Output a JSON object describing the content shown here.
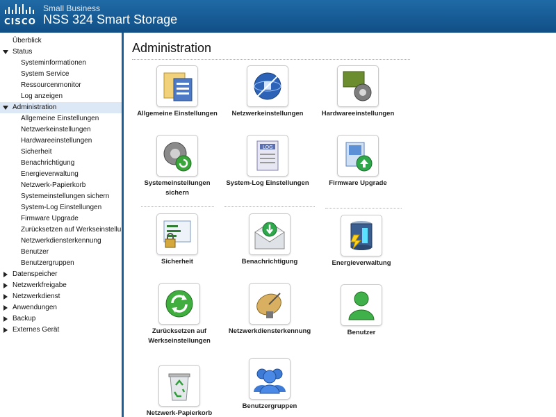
{
  "header": {
    "brand": "CISCO",
    "subtitle": "Small Business",
    "title": "NSS 324 Smart Storage"
  },
  "sidebar": {
    "items": [
      {
        "label": "Überblick",
        "level": "top"
      },
      {
        "label": "Status",
        "level": "top",
        "expanded": true
      },
      {
        "label": "Systeminformationen",
        "level": "sub"
      },
      {
        "label": "System Service",
        "level": "sub"
      },
      {
        "label": "Ressourcenmonitor",
        "level": "sub"
      },
      {
        "label": "Log anzeigen",
        "level": "sub"
      },
      {
        "label": "Administration",
        "level": "top",
        "expanded": true,
        "selected": true
      },
      {
        "label": "Allgemeine Einstellungen",
        "level": "sub"
      },
      {
        "label": "Netzwerkeinstellungen",
        "level": "sub"
      },
      {
        "label": "Hardwareeinstellungen",
        "level": "sub"
      },
      {
        "label": "Sicherheit",
        "level": "sub"
      },
      {
        "label": "Benachrichtigung",
        "level": "sub"
      },
      {
        "label": "Energieverwaltung",
        "level": "sub"
      },
      {
        "label": "Netzwerk-Papierkorb",
        "level": "sub"
      },
      {
        "label": "Systemeinstellungen sichern",
        "level": "sub"
      },
      {
        "label": "System-Log Einstellungen",
        "level": "sub"
      },
      {
        "label": "Firmware Upgrade",
        "level": "sub"
      },
      {
        "label": "Zurücksetzen auf Werkseinstellungen",
        "level": "sub"
      },
      {
        "label": "Netzwerkdiensterkennung",
        "level": "sub"
      },
      {
        "label": "Benutzer",
        "level": "sub"
      },
      {
        "label": "Benutzergruppen",
        "level": "sub"
      },
      {
        "label": "Datenspeicher",
        "level": "top",
        "expanded": false
      },
      {
        "label": "Netzwerkfreigabe",
        "level": "top",
        "expanded": false
      },
      {
        "label": "Netzwerkdienst",
        "level": "top",
        "expanded": false
      },
      {
        "label": "Anwendungen",
        "level": "top",
        "expanded": false
      },
      {
        "label": "Backup",
        "level": "top",
        "expanded": false
      },
      {
        "label": "Externes Gerät",
        "level": "top",
        "expanded": false
      }
    ]
  },
  "main": {
    "title": "Administration",
    "tiles": [
      {
        "label": "Allgemeine Einstellungen",
        "icon": "general-settings-icon"
      },
      {
        "label": "Netzwerkeinstellungen",
        "icon": "network-settings-icon"
      },
      {
        "label": "Hardwareeinstellungen",
        "icon": "hardware-settings-icon"
      },
      {
        "label": "Systemeinstellungen sichern",
        "icon": "backup-settings-icon"
      },
      {
        "label": "System-Log Einstellungen",
        "icon": "system-log-icon"
      },
      {
        "label": "Firmware Upgrade",
        "icon": "firmware-upgrade-icon"
      },
      {
        "label": "Sicherheit",
        "icon": "security-icon"
      },
      {
        "label": "Benachrichtigung",
        "icon": "notification-icon"
      },
      {
        "label": "Energieverwaltung",
        "icon": "power-management-icon"
      },
      {
        "label": "Zurücksetzen auf Werkseinstellungen",
        "icon": "factory-reset-icon"
      },
      {
        "label": "Netzwerkdiensterkennung",
        "icon": "service-discovery-icon"
      },
      {
        "label": "Benutzer",
        "icon": "user-icon"
      },
      {
        "label": "Netzwerk-Papierkorb",
        "icon": "recycle-bin-icon"
      },
      {
        "label": "Benutzergruppen",
        "icon": "user-groups-icon"
      }
    ]
  },
  "colors": {
    "header": "#1a5f9a",
    "sidebar_border": "#1c5e98",
    "selected_bg": "#dde8f7"
  }
}
